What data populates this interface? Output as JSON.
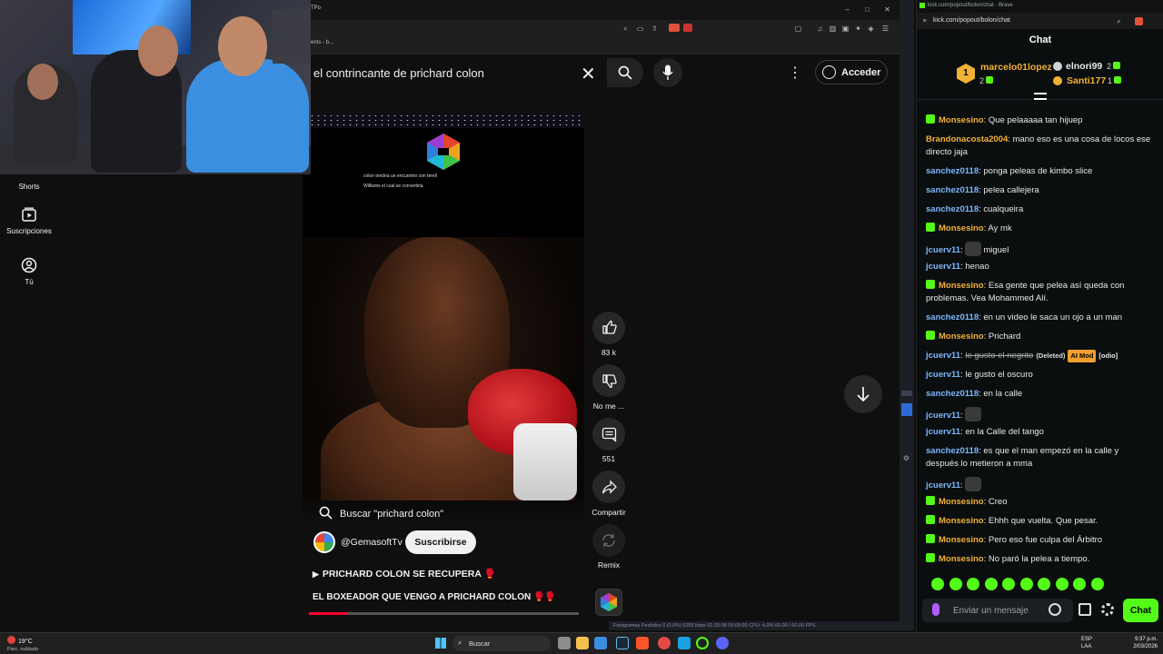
{
  "youtube": {
    "bookmark_fragment": "ents - b...",
    "tab_fragment": "TPo",
    "search_query": "el contrincante de prichard colon",
    "login_label": "Acceder",
    "sidebar": [
      {
        "label": "Shorts"
      },
      {
        "label": "Suscripciones"
      },
      {
        "label": "Tú"
      }
    ],
    "video": {
      "caption_line1": "colon tendria un encuentro con terell",
      "caption_line2": "Williams el cual se convertiria",
      "search_overlay": "Buscar \"prichard colon\"",
      "channel": "@GemasoftTv",
      "subscribe_label": "Suscribirse",
      "title_1": "PRICHARD COLON SE RECUPERA 🥊",
      "title_2": "EL BOXEADOR QUE VENGO A PRICHARD COLON 🥊🥊",
      "progress_fraction": 0.14
    },
    "actions": {
      "likes": "83 k",
      "dislike_label": "No me ...",
      "comments": "551",
      "share_label": "Compartir",
      "remix_label": "Remix"
    }
  },
  "obs_stats": "Fotogramas Perdidos 0 (0.0%)     5285 kbps     01:20:08     00:00:00     CPU: 4.0%     60.00 / 60.00 FPS",
  "chat": {
    "tab_title": "kick.com/popout/bolon/chat - Brave",
    "url": "kick.com/popout/bolon/chat",
    "title": "Chat",
    "leaderboard": [
      {
        "rank": "1",
        "name": "marcelo01lopez",
        "count": "2",
        "color": "#f2b134"
      },
      {
        "rank": "",
        "name": "elnori99",
        "count": "2",
        "color": "#e8e8e8"
      },
      {
        "rank": "",
        "name": "Santi177",
        "count": "1",
        "color": "#f2b134"
      }
    ],
    "messages": [
      {
        "user": "Monsesino",
        "color": "#f2b134",
        "mod": true,
        "text": "Que pelaaaaa tan hijuep"
      },
      {
        "user": "Brandonacosta2004",
        "color": "#f2b134",
        "mod": false,
        "text": "mano eso es una cosa de locos ese directo jaja"
      },
      {
        "user": "sanchez0118",
        "color": "#7ab8ff",
        "mod": false,
        "text": "ponga peleas de kimbo slice"
      },
      {
        "user": "sanchez0118",
        "color": "#7ab8ff",
        "mod": false,
        "text": "pelea callejera"
      },
      {
        "user": "sanchez0118",
        "color": "#7ab8ff",
        "mod": false,
        "text": "cualqueira"
      },
      {
        "user": "Monsesino",
        "color": "#f2b134",
        "mod": true,
        "text": "Ay mk"
      },
      {
        "user": "jcuerv11",
        "color": "#7ab8ff",
        "mod": false,
        "text": "miguel",
        "emote": true
      },
      {
        "user": "jcuerv11",
        "color": "#7ab8ff",
        "mod": false,
        "text": "henao"
      },
      {
        "user": "Monsesino",
        "color": "#f2b134",
        "mod": true,
        "text": "Esa gente que pelea así queda con problemas. Vea Mohammed Alí."
      },
      {
        "user": "sanchez0118",
        "color": "#7ab8ff",
        "mod": false,
        "text": "en un video le saca un ojo a un man"
      },
      {
        "user": "Monsesino",
        "color": "#f2b134",
        "mod": true,
        "text": "Prichard"
      },
      {
        "user": "jcuerv11",
        "color": "#7ab8ff",
        "mod": false,
        "text": "le gusto el negrito",
        "deleted": true,
        "deleted_label": "(Deleted)",
        "ai_label": "AI Mod",
        "reason": "[odio]"
      },
      {
        "user": "jcuerv11",
        "color": "#7ab8ff",
        "mod": false,
        "text": "le gusto el oscuro"
      },
      {
        "user": "sanchez0118",
        "color": "#7ab8ff",
        "mod": false,
        "text": "en la calle"
      },
      {
        "user": "jcuerv11",
        "color": "#7ab8ff",
        "mod": false,
        "text": "",
        "emote": true
      },
      {
        "user": "jcuerv11",
        "color": "#7ab8ff",
        "mod": false,
        "text": "en la Calle del tango"
      },
      {
        "user": "sanchez0118",
        "color": "#7ab8ff",
        "mod": false,
        "text": "es que el man empezó en la calle y después lo metieron a mma"
      },
      {
        "user": "jcuerv11",
        "color": "#7ab8ff",
        "mod": false,
        "text": "",
        "emote": true
      },
      {
        "user": "Monsesino",
        "color": "#f2b134",
        "mod": true,
        "text": "Creo"
      },
      {
        "user": "Monsesino",
        "color": "#f2b134",
        "mod": true,
        "text": "Ehhh que vuelta. Que pesar."
      },
      {
        "user": "Monsesino",
        "color": "#f2b134",
        "mod": true,
        "text": "Pero eso fue culpa del Árbitro"
      },
      {
        "user": "Monsesino",
        "color": "#f2b134",
        "mod": true,
        "text": "No paró la pelea a tiempo."
      }
    ],
    "input_placeholder": "Enviar un mensaje",
    "send_label": "Chat"
  },
  "taskbar": {
    "weather_temp": "19°C",
    "weather_desc": "Parc. nublado",
    "search_label": "Buscar",
    "lang_1": "ESP",
    "lang_2": "LAA",
    "time": "9:37 p.m.",
    "date": "2/03/2026"
  },
  "colors": {
    "kick_green": "#53fc18",
    "yt_red": "#ff0033",
    "bg": "#0f0f0f"
  }
}
